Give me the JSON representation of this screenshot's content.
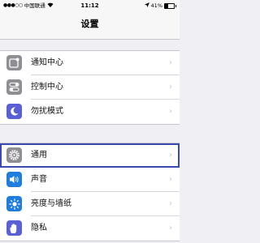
{
  "status_bar": {
    "carrier": "中国联通",
    "time": "11:12",
    "battery": "41%"
  },
  "nav": {
    "title": "设置"
  },
  "groups": [
    {
      "items": [
        {
          "label": "通知中心",
          "icon": "notification-center-icon"
        },
        {
          "label": "控制中心",
          "icon": "control-center-icon"
        },
        {
          "label": "勿扰模式",
          "icon": "do-not-disturb-icon"
        }
      ]
    },
    {
      "items": [
        {
          "label": "通用",
          "icon": "gear-icon",
          "highlighted": true
        },
        {
          "label": "声音",
          "icon": "speaker-icon"
        },
        {
          "label": "亮度与墙纸",
          "icon": "brightness-icon"
        },
        {
          "label": "隐私",
          "icon": "hand-icon"
        }
      ]
    }
  ],
  "colors": {
    "highlight_border": "#3a49b5",
    "icon_blue": "#1f7de0",
    "icon_gray": "#8e8e93",
    "icon_purple": "#5b5fd6"
  },
  "chevron": "›"
}
